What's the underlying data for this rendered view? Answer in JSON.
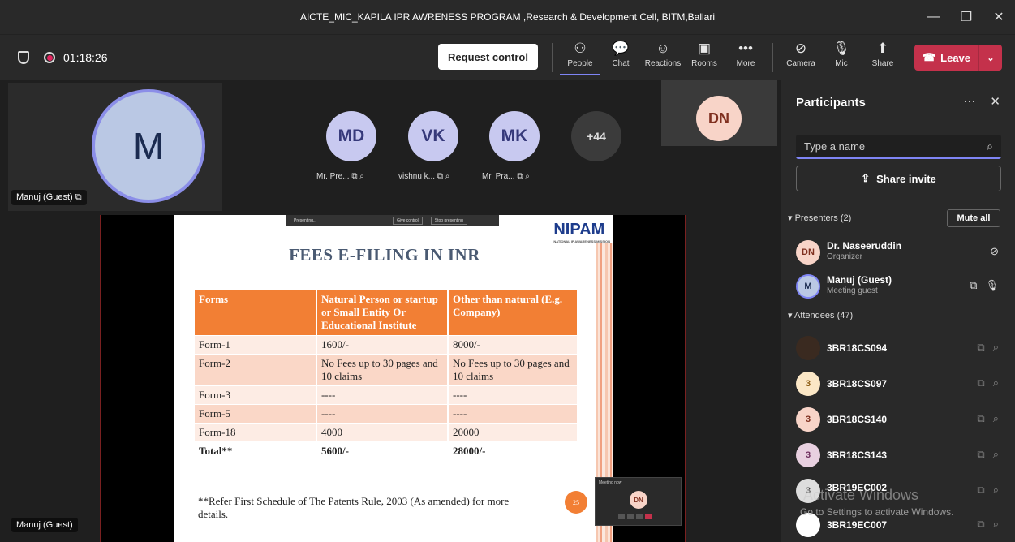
{
  "window": {
    "title": "AICTE_MIC_KAPILA IPR AWRENESS PROGRAM ,Research & Development Cell, BITM,Ballari",
    "controls": [
      "—",
      "❐",
      "✕"
    ]
  },
  "toolbar": {
    "timer": "01:18:26",
    "request_control": "Request control",
    "items": [
      {
        "label": "People",
        "glyph": "⚇"
      },
      {
        "label": "Chat",
        "glyph": "💬"
      },
      {
        "label": "Reactions",
        "glyph": "☺"
      },
      {
        "label": "Rooms",
        "glyph": "▣"
      },
      {
        "label": "More",
        "glyph": "•••"
      },
      {
        "label": "Camera",
        "glyph": "⊘"
      },
      {
        "label": "Mic",
        "glyph": "🎙"
      },
      {
        "label": "Share",
        "glyph": "⬆"
      }
    ],
    "leave": "Leave"
  },
  "stage": {
    "self_initial": "M",
    "self_name": "Manuj (Guest)",
    "participants": [
      {
        "initials": "MD",
        "name": "Mr. Pre...",
        "bg": "#c8c9f0",
        "fg": "#36397a"
      },
      {
        "initials": "VK",
        "name": "vishnu k...",
        "bg": "#c8c9f0",
        "fg": "#36397a"
      },
      {
        "initials": "MK",
        "name": "Mr. Pra...",
        "bg": "#c8c9f0",
        "fg": "#36397a"
      }
    ],
    "overflow": "+44",
    "organizer_initials": "DN",
    "bottom_name": "Manuj (Guest)"
  },
  "slide": {
    "presenting_bar": {
      "label": "Presenting...",
      "give": "Give control",
      "stop": "Stop presenting"
    },
    "logo": "NIPAM",
    "logo_sub": "NATIONAL IP AWARENESS MISSION",
    "title": "FEES E-FILING IN INR",
    "headers": [
      "Forms",
      "Natural Person or startup or Small Entity Or Educational Institute",
      "Other than natural (E.g. Company)"
    ],
    "rows": [
      [
        "Form-1",
        "1600/-",
        "8000/-"
      ],
      [
        "Form-2",
        "No Fees up to 30 pages and 10 claims",
        "No Fees up to 30 pages and 10 claims"
      ],
      [
        "Form-3",
        "----",
        "----"
      ],
      [
        "Form-5",
        "----",
        "----"
      ],
      [
        "Form-18",
        "4000",
        "20000"
      ]
    ],
    "total": [
      "Total**",
      "5600/-",
      "28000/-"
    ],
    "footnote": "**Refer First Schedule of The Patents Rule, 2003 (As amended) for more details.",
    "page": "25"
  },
  "mini_meeting": {
    "label": "Meeting now",
    "initials": "DN"
  },
  "panel": {
    "title": "Participants",
    "search_placeholder": "Type a name",
    "share_invite": "Share invite",
    "presenters_label": "Presenters (2)",
    "mute_all": "Mute all",
    "presenters": [
      {
        "initials": "DN",
        "name": "Dr. Naseeruddin",
        "role": "Organizer",
        "bg": "#f8d4c8",
        "fg": "#803020"
      },
      {
        "initials": "M",
        "name": "Manuj (Guest)",
        "role": "Meeting guest",
        "bg": "#bac8e4",
        "fg": "#1b2b50"
      }
    ],
    "attendees_label": "Attendees (47)",
    "attendees": [
      {
        "initials": "",
        "name": "3BR18CS094",
        "bg": "#3a2a20",
        "fg": "#fff"
      },
      {
        "initials": "3",
        "name": "3BR18CS097",
        "bg": "#fbe7c6",
        "fg": "#8a5a10"
      },
      {
        "initials": "3",
        "name": "3BR18CS140",
        "bg": "#f8d4c8",
        "fg": "#803020"
      },
      {
        "initials": "3",
        "name": "3BR18CS143",
        "bg": "#e8d0e0",
        "fg": "#703060"
      },
      {
        "initials": "3",
        "name": "3BR19EC002",
        "bg": "#ddd",
        "fg": "#444"
      },
      {
        "initials": "",
        "name": "3BR19EC007",
        "bg": "#fff",
        "fg": "#444"
      }
    ]
  },
  "watermark": {
    "line1": "Activate Windows",
    "line2": "Go to Settings to activate Windows."
  }
}
